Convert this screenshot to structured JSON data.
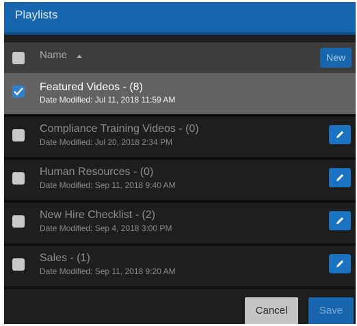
{
  "window": {
    "title": "Playlists"
  },
  "header": {
    "name_label": "Name",
    "new_button": "New"
  },
  "playlists": [
    {
      "title": "Featured Videos - (8)",
      "date": "Date Modified: Jul 11, 2018 11:59 AM",
      "checked": true
    },
    {
      "title": "Compliance Training Videos - (0)",
      "date": "Date Modified: Jul 20, 2018 2:34 PM",
      "checked": false
    },
    {
      "title": "Human Resources - (0)",
      "date": "Date Modified: Sep 11, 2018 9:40 AM",
      "checked": false
    },
    {
      "title": "New Hire Checklist - (2)",
      "date": "Date Modified: Sep 4, 2018 3:00 PM",
      "checked": false
    },
    {
      "title": "Sales - (1)",
      "date": "Date Modified: Sep 11, 2018 9:20 AM",
      "checked": false
    }
  ],
  "footer": {
    "cancel_label": "Cancel",
    "save_label": "Save"
  },
  "colors": {
    "accent": "#1766ad",
    "selected_row": "#626262",
    "background": "#1e1e1e"
  },
  "icons": {
    "edit": "pencil-icon",
    "checkmark": "checkmark-icon",
    "sort": "sort-ascending-icon"
  }
}
